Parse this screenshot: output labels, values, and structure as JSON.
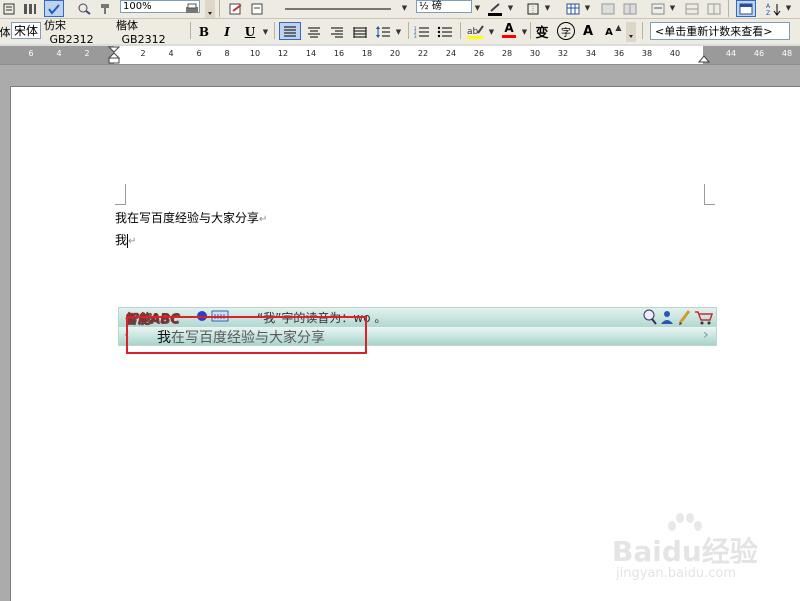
{
  "toolbar1": {
    "zoom": "100%",
    "fragment": "½ 磅"
  },
  "toolbar2": {
    "style_fragment": "体",
    "fonts": [
      "宋体",
      "仿宋_GB2312",
      "楷体_GB2312"
    ],
    "bold": "B",
    "italic": "I",
    "underline": "U",
    "font_color_letter": "A",
    "char_scale_glyph": "变",
    "phonetic_glyph": "字",
    "grow_font": "A",
    "shrink_font": "A",
    "word_count": "<单击重新计数来查看>"
  },
  "ruler": {
    "ticks": [
      "6",
      "4",
      "2",
      "2",
      "4",
      "6",
      "8",
      "10",
      "12",
      "14",
      "16",
      "18",
      "20",
      "22",
      "24",
      "26",
      "28",
      "30",
      "32",
      "34",
      "36",
      "38",
      "40",
      "44",
      "46",
      "48"
    ]
  },
  "document": {
    "line1": "我在写百度经验与大家分享",
    "line2": "我",
    "return_mark": "↵"
  },
  "ime": {
    "brand": "智能ABC",
    "pronunciation": "“我”字的读音为：wo 。",
    "composition_highlight": "我",
    "composition_rest": "在写百度经验与大家分享",
    "prev": "‹",
    "next": "›"
  },
  "watermark": {
    "brand": "Baidu经验",
    "url": "jingyan.baidu.com"
  }
}
